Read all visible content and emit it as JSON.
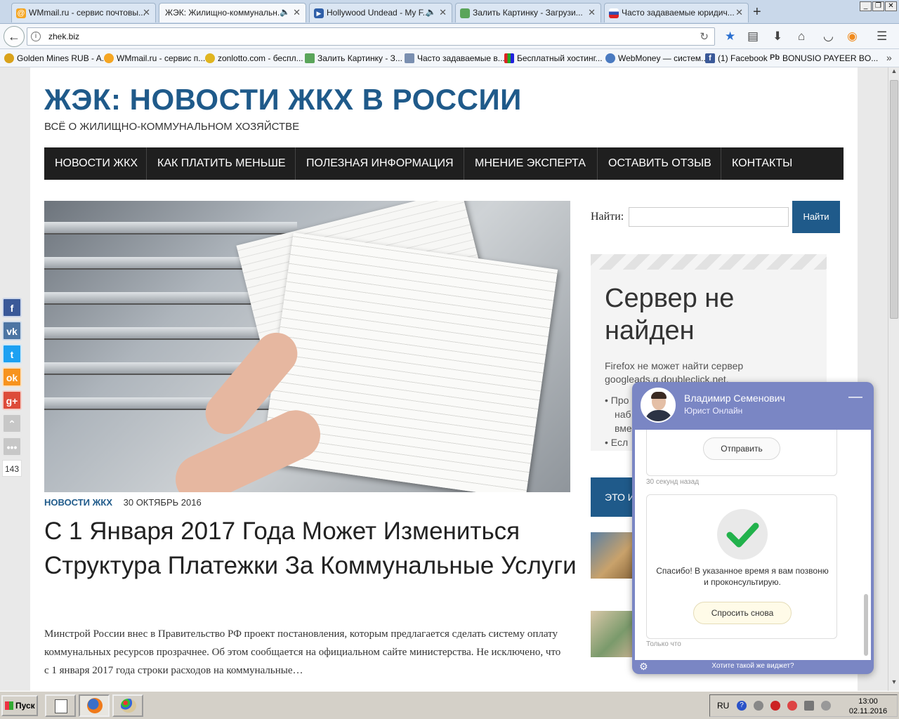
{
  "browser": {
    "tabs": [
      {
        "label": "WMmail.ru - сервис почтовы...",
        "icon": "at-icon"
      },
      {
        "label": "ЖЭК: Жилищно-коммунальн...",
        "icon": "sound-icon"
      },
      {
        "label": "Hollywood Undead - My F...",
        "icon": "play-icon"
      },
      {
        "label": "Залить Картинку - Загрузи...",
        "icon": "image-icon"
      },
      {
        "label": "Часто задаваемые юридич...",
        "icon": "flag-icon"
      }
    ],
    "url": "zhek.biz",
    "bookmarks": [
      "Golden Mines RUB - A...",
      "WMmail.ru - сервис п...",
      "zonlotto.com - беспл...",
      "Залить Картинку - З...",
      "Часто задаваемые в...",
      "Бесплатный хостинг...",
      "WebMoney — систем...",
      "(1) Facebook",
      "BONUSIO PAYEER BO..."
    ]
  },
  "site": {
    "title": "ЖЭК: НОВОСТИ ЖКХ В РОССИИ",
    "subtitle": "ВСЁ О ЖИЛИЩНО-КОММУНАЛЬНОМ ХОЗЯЙСТВЕ",
    "nav": [
      "НОВОСТИ ЖКХ",
      "КАК ПЛАТИТЬ МЕНЬШЕ",
      "ПОЛЕЗНАЯ ИНФОРМАЦИЯ",
      "МНЕНИЕ ЭКСПЕРТА",
      "ОСТАВИТЬ ОТЗЫВ",
      "КОНТАКТЫ"
    ]
  },
  "post": {
    "category": "НОВОСТИ ЖКХ",
    "date": "30 ОКТЯБРЬ 2016",
    "title": "С 1 Января 2017 Года Может Измениться Структура Платежки За Коммунальные Услуги",
    "excerpt": "Минстрой России внес в Правительство РФ проект постановления, которым предлагается сделать систему оплату коммунальных ресурсов прозрачнее. Об этом сообщается на официальном сайте министерства. Не исключено, что с 1 января 2017 года строки расходов на коммунальные…"
  },
  "sidebar": {
    "search_label": "Найти:",
    "search_button": "Найти",
    "error_title": "Сервер не найден",
    "error_text": "Firefox не может найти сервер googleads.g.doubleclick.net.",
    "error_list": [
      "Про",
      "наб",
      "вме",
      "Есл"
    ],
    "blue_widget": "ЭТО И"
  },
  "share": {
    "count": "143"
  },
  "chat": {
    "name": "Владимир Семенович",
    "role": "Юрист Онлайн",
    "send_button": "Отправить",
    "time1": "30 секунд назад",
    "thanks": "Спасибо! В указанное время я вам позвоню и проконсультирую.",
    "ask_again": "Спросить снова",
    "time2": "Только что",
    "footer": "Хотите такой же виджет?"
  },
  "taskbar": {
    "start": "Пуск",
    "lang": "RU",
    "time": "13:00",
    "date": "02.11.2016"
  }
}
